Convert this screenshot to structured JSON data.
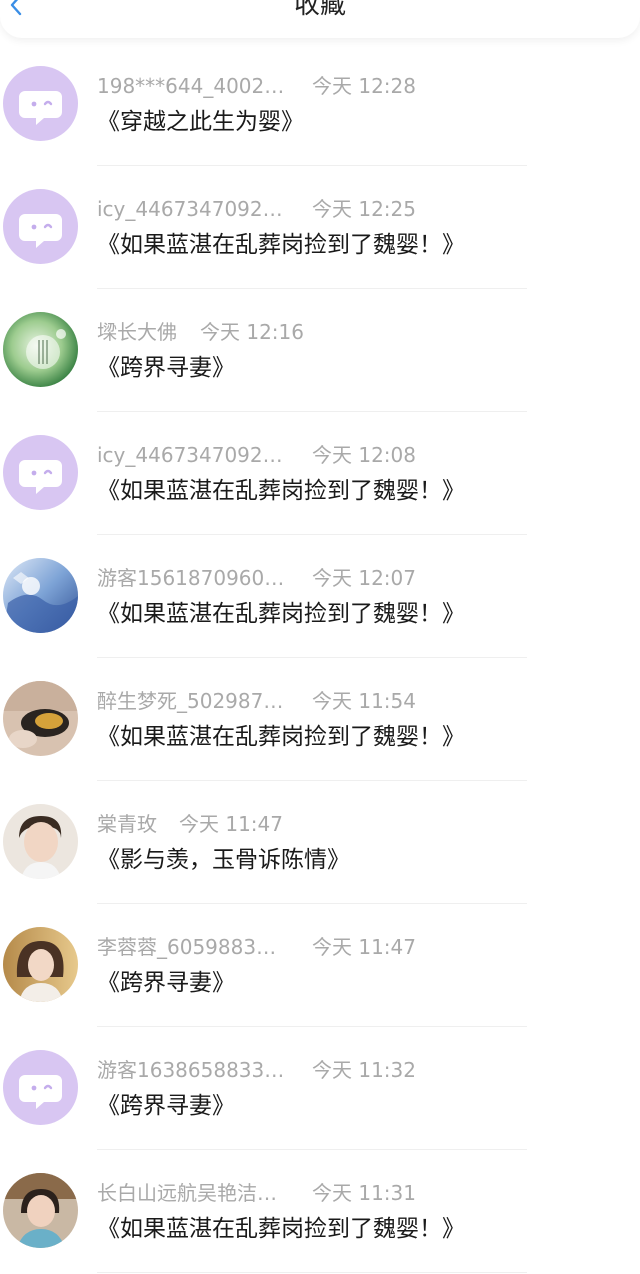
{
  "header": {
    "title": "收藏",
    "back_icon": "chevron-left-icon",
    "accent_color": "#3a8ee6"
  },
  "colors": {
    "meta_text": "#a9a9a9",
    "title_text": "#1a1a1a",
    "default_avatar_bg": "#d8c6f2"
  },
  "items": [
    {
      "nickname": "198***644_4002…",
      "time": "今天 12:28",
      "title": "《穿越之此生为婴》",
      "avatar": "default-chat-avatar"
    },
    {
      "nickname": "icy_4467347092…",
      "time": "今天 12:25",
      "title": "《如果蓝湛在乱葬岗捡到了魏婴！》",
      "avatar": "default-chat-avatar"
    },
    {
      "nickname": "墚长大佛",
      "time": "今天 12:16",
      "title": "《跨界寻妻》",
      "avatar": "green-jade-avatar"
    },
    {
      "nickname": "icy_4467347092…",
      "time": "今天 12:08",
      "title": "《如果蓝湛在乱葬岗捡到了魏婴！》",
      "avatar": "default-chat-avatar"
    },
    {
      "nickname": "游客1561870960…",
      "time": "今天 12:07",
      "title": "《如果蓝湛在乱葬岗捡到了魏婴！》",
      "avatar": "blue-art-avatar"
    },
    {
      "nickname": "醉生梦死_502987…",
      "time": "今天 11:54",
      "title": "《如果蓝湛在乱葬岗捡到了魏婴！》",
      "avatar": "photo-avatar"
    },
    {
      "nickname": "棠青玫",
      "time": "今天 11:47",
      "title": "《影与羡，玉骨诉陈情》",
      "avatar": "portrait-avatar"
    },
    {
      "nickname": "李蓉蓉_6059883…",
      "time": "今天 11:47",
      "title": "《跨界寻妻》",
      "avatar": "portrait-avatar"
    },
    {
      "nickname": "游客1638658833…",
      "time": "今天 11:32",
      "title": "《跨界寻妻》",
      "avatar": "default-chat-avatar"
    },
    {
      "nickname": "长白山远航吴艳洁…",
      "time": "今天 11:31",
      "title": "《如果蓝湛在乱葬岗捡到了魏婴！》",
      "avatar": "portrait-avatar"
    }
  ]
}
